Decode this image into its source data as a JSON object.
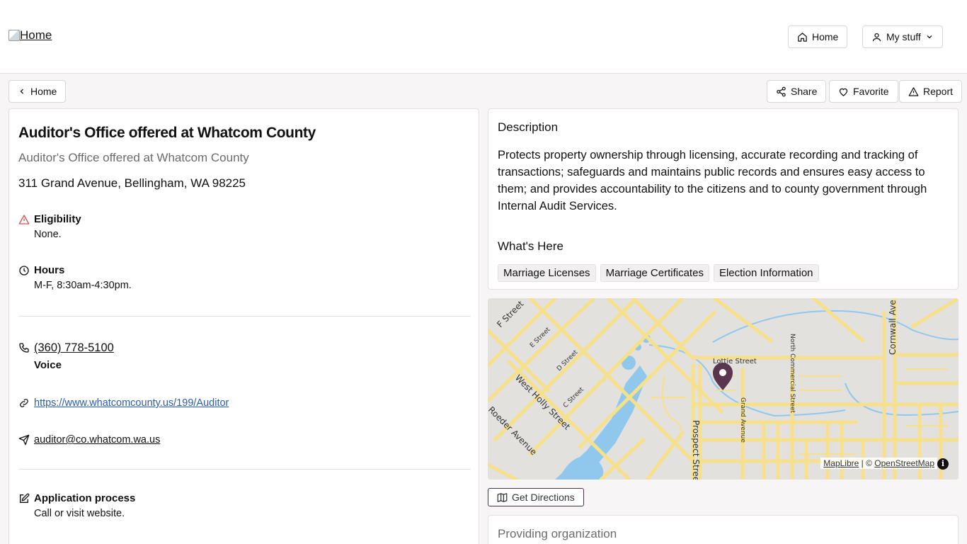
{
  "header": {
    "logo_alt": "Home",
    "home_label": "Home",
    "my_stuff_label": "My stuff"
  },
  "toolbar": {
    "back_label": "Home",
    "share_label": "Share",
    "favorite_label": "Favorite",
    "report_label": "Report"
  },
  "service": {
    "title": "Auditor's Office offered at Whatcom County",
    "subtitle": "Auditor's Office offered at Whatcom County",
    "address": "311 Grand Avenue, Bellingham, WA 98225",
    "eligibility_label": "Eligibility",
    "eligibility_value": "None.",
    "hours_label": "Hours",
    "hours_value": "M-F, 8:30am-4:30pm.",
    "phone": "(360) 778-5100",
    "phone_type": "Voice",
    "website": "https://www.whatcomcounty.us/199/Auditor",
    "email": "auditor@co.whatcom.wa.us",
    "application_label": "Application process",
    "application_value": "Call or visit website."
  },
  "description": {
    "heading": "Description",
    "text": "Protects property ownership through licensing, accurate recording and tracking of transactions; safeguards and maintains public records and ensures easy access to them; and provides accountability to the citizens and to county government through Internal Audit Services.",
    "whats_here_heading": "What's Here",
    "tags": [
      "Marriage Licenses",
      "Marriage Certificates",
      "Election Information"
    ]
  },
  "map": {
    "labels": {
      "f_street": "F Street",
      "e_street": "E Street",
      "d_street": "D Street",
      "c_street": "C Street",
      "west_holly": "West Holly Street",
      "roeder": "Roeder Avenue",
      "lottie": "Lottie Street",
      "grand": "Grand Avenue",
      "prospect": "Prospect Stree",
      "north_commercial": "North Commercial Street",
      "cornwall": "Cornwall Ave"
    },
    "attribution_maplibre": "MapLibre",
    "attribution_sep": " | © ",
    "attribution_osm": "OpenStreetMap",
    "info": "i",
    "directions_label": "Get Directions",
    "colors": {
      "road": "#f6e08b",
      "water": "#8fc8ec",
      "land": "#e3e1de",
      "pin": "#5a3550"
    }
  },
  "organization": {
    "heading": "Providing organization"
  }
}
